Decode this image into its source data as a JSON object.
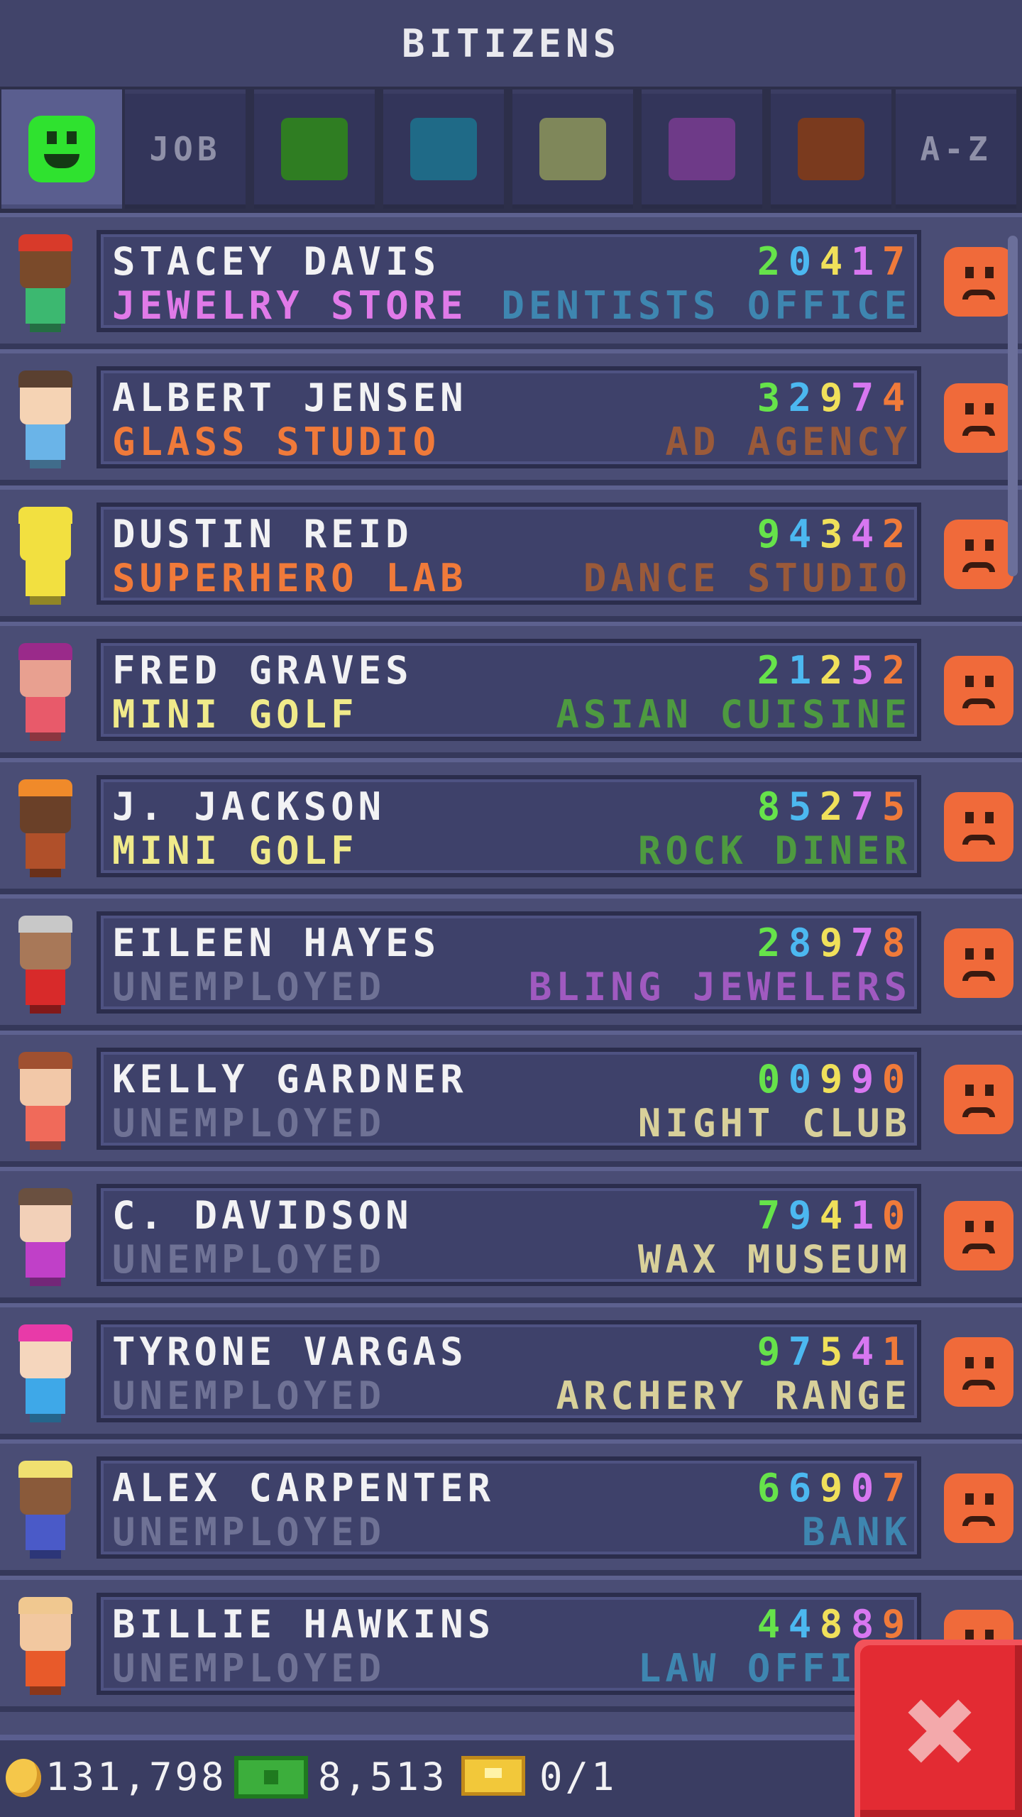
{
  "header": {
    "title": "BITIZENS"
  },
  "tabs": [
    {
      "key": "happiness",
      "label": "",
      "icon": "smiley-icon",
      "color": "#2fe22f",
      "active": true
    },
    {
      "key": "job",
      "label": "JOB"
    },
    {
      "key": "food",
      "label": "",
      "icon": "green-swatch-icon",
      "color": "#2f7d22"
    },
    {
      "key": "service",
      "label": "",
      "icon": "blue-swatch-icon",
      "color": "#1f6a87"
    },
    {
      "key": "recreation",
      "label": "",
      "icon": "olive-swatch-icon",
      "color": "#7f875a"
    },
    {
      "key": "retail",
      "label": "",
      "icon": "purple-swatch-icon",
      "color": "#6e3a88"
    },
    {
      "key": "creative",
      "label": "",
      "icon": "brown-swatch-icon",
      "color": "#7a3a1e"
    },
    {
      "key": "alpha",
      "label": "A-Z"
    }
  ],
  "digit_colors": [
    "#66e34a",
    "#4cb8f0",
    "#f0e05a",
    "#d777f0",
    "#f07a3a"
  ],
  "residents": [
    {
      "name": "STACEY DAVIS",
      "job": "JEWELRY STORE",
      "job_color": "#e07ae8",
      "number": "20417",
      "dream_job": "DENTISTS OFFICE",
      "dream_color": "#3e86b0",
      "skin": "#7a4a2a",
      "hair": "#d83a2a",
      "shirt": "#3cb870"
    },
    {
      "name": "ALBERT JENSEN",
      "job": "GLASS STUDIO",
      "job_color": "#f07a3a",
      "number": "32974",
      "dream_job": "AD AGENCY",
      "dream_color": "#9a5a3a",
      "skin": "#f5d3b4",
      "hair": "#5a4030",
      "shirt": "#6ab4e8"
    },
    {
      "name": "DUSTIN REID",
      "job": "SUPERHERO LAB",
      "job_color": "#f07a3a",
      "number": "94342",
      "dream_job": "DANCE STUDIO",
      "dream_color": "#9a5a3a",
      "skin": "#f2e040",
      "hair": "#f2e040",
      "shirt": "#f2e040"
    },
    {
      "name": "FRED GRAVES",
      "job": "MINI GOLF",
      "job_color": "#f0ea8a",
      "number": "21252",
      "dream_job": "ASIAN CUISINE",
      "dream_color": "#4e9a40",
      "skin": "#e8a090",
      "hair": "#9a2a8a",
      "shirt": "#e85a6a"
    },
    {
      "name": "J. JACKSON",
      "job": "MINI GOLF",
      "job_color": "#f0ea8a",
      "number": "85275",
      "dream_job": "ROCK DINER",
      "dream_color": "#4e9a40",
      "skin": "#6a4028",
      "hair": "#f08a2a",
      "shirt": "#b0502a"
    },
    {
      "name": "EILEEN HAYES",
      "job": "UNEMPLOYED",
      "job_color": "#6f7295",
      "number": "28978",
      "dream_job": "BLING JEWELERS",
      "dream_color": "#a05ac0",
      "skin": "#a87858",
      "hair": "#c8c8c8",
      "shirt": "#d82a2a"
    },
    {
      "name": "KELLY GARDNER",
      "job": "UNEMPLOYED",
      "job_color": "#6f7295",
      "number": "00990",
      "dream_job": "NIGHT CLUB",
      "dream_color": "#d8d09a",
      "skin": "#f2c8a8",
      "hair": "#a05030",
      "shirt": "#f06a5a"
    },
    {
      "name": "C. DAVIDSON",
      "job": "UNEMPLOYED",
      "job_color": "#6f7295",
      "number": "79410",
      "dream_job": "WAX MUSEUM",
      "dream_color": "#d8d09a",
      "skin": "#f2d0b8",
      "hair": "#6a5040",
      "shirt": "#c040c8"
    },
    {
      "name": "TYRONE VARGAS",
      "job": "UNEMPLOYED",
      "job_color": "#6f7295",
      "number": "97541",
      "dream_job": "ARCHERY RANGE",
      "dream_color": "#d8d09a",
      "skin": "#f5d6bd",
      "hair": "#e83aa8",
      "shirt": "#3ea8e8"
    },
    {
      "name": "ALEX CARPENTER",
      "job": "UNEMPLOYED",
      "job_color": "#6f7295",
      "number": "66907",
      "dream_job": "BANK",
      "dream_color": "#3e86b0",
      "skin": "#8a5a3a",
      "hair": "#f0e070",
      "shirt": "#4a5ac8"
    },
    {
      "name": "BILLIE HAWKINS",
      "job": "UNEMPLOYED",
      "job_color": "#6f7295",
      "number": "44889",
      "dream_job": "LAW OFFICE",
      "dream_color": "#3e86b0",
      "skin": "#f2c8a0",
      "hair": "#f0c890",
      "shirt": "#e85a2a"
    }
  ],
  "footer": {
    "coins": "131,798",
    "bux": "8,513",
    "tickets": "0/1"
  },
  "colors": {
    "close_button": "#e32b33",
    "frown_face": "#f06a3a"
  }
}
